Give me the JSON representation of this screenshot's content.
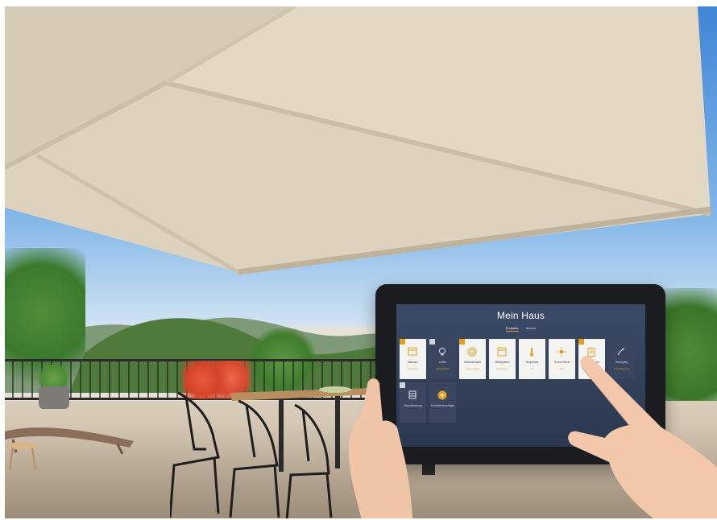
{
  "screen": {
    "title": "Mein Haus",
    "tabs": [
      {
        "label": "Produkte",
        "active": true
      },
      {
        "label": "Alarme",
        "active": false
      }
    ],
    "tiles": [
      {
        "name": "Markisen",
        "status": "Eingefahren",
        "theme": "light",
        "icon": "awning-icon"
      },
      {
        "name": "Lichter",
        "status": "Ausgeschaltet",
        "theme": "dark",
        "icon": "bulb-icon"
      },
      {
        "name": "Zentralschalter",
        "status": "Ausgeschaltet",
        "theme": "light",
        "icon": "target-icon"
      },
      {
        "name": "Wintergarten",
        "status": "Eingefahren",
        "theme": "light",
        "icon": "window-icon"
      },
      {
        "name": "Temperatur",
        "status": "22°",
        "theme": "light",
        "icon": "thermometer-icon"
      },
      {
        "name": "Sonne Status",
        "status": "Stufe",
        "theme": "light",
        "icon": "sun-icon"
      },
      {
        "name": "Wohnzimmer",
        "status": "Aus",
        "theme": "light",
        "icon": "clipboard-icon"
      },
      {
        "name": "Bewegung",
        "status": "Keine Bewegung",
        "theme": "dark",
        "icon": "motion-icon"
      },
      {
        "name": "Raumstimmung",
        "status": "",
        "theme": "dark",
        "icon": "blinds-icon"
      },
      {
        "name": "Produkte hinzufügen",
        "status": "",
        "theme": "dark",
        "icon": "add-icon"
      }
    ]
  },
  "colors": {
    "accent": "#e3a01e",
    "screen_bg": "#33405a",
    "sky": "#3f86d6",
    "awning": "#e2d7c3"
  }
}
